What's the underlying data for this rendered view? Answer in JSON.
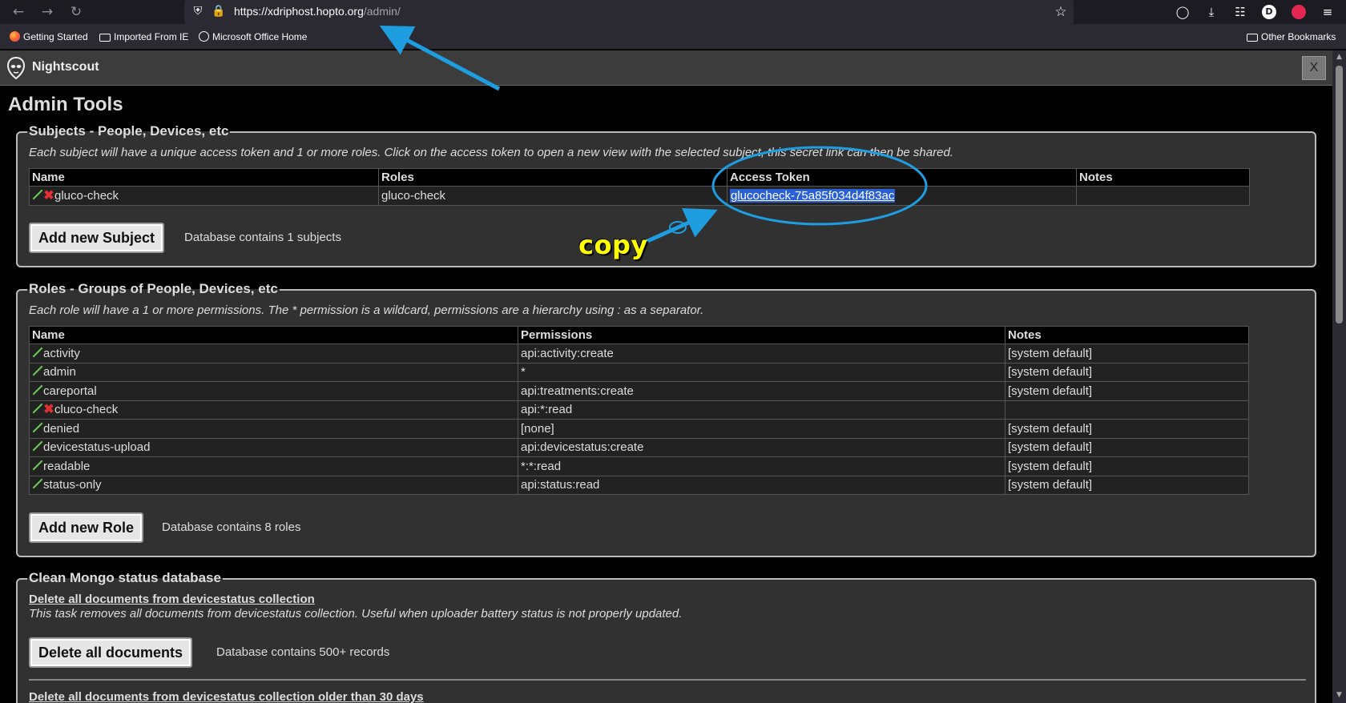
{
  "browser": {
    "url_host": "https://xdriphost.hopto.org",
    "url_path": "/admin/",
    "profile_initial": "D",
    "bookmarks": [
      "Getting Started",
      "Imported From IE",
      "Microsoft Office Home"
    ],
    "other_bookmarks": "Other Bookmarks"
  },
  "app": {
    "name": "Nightscout",
    "close_label": "X"
  },
  "page": {
    "title": "Admin Tools"
  },
  "subjects": {
    "legend": "Subjects - People, Devices, etc",
    "description": "Each subject will have a unique access token and 1 or more roles. Click on the access token to open a new view with the selected subject, this secret link can then be shared.",
    "columns": [
      "Name",
      "Roles",
      "Access Token",
      "Notes"
    ],
    "rows": [
      {
        "name": "gluco-check",
        "roles": "gluco-check",
        "token": "glucocheck-75a85f034d4f83ac",
        "notes": ""
      }
    ],
    "add_button": "Add new Subject",
    "count_text": "Database contains 1 subjects"
  },
  "roles": {
    "legend": "Roles - Groups of People, Devices, etc",
    "description": "Each role will have a 1 or more permissions. The * permission is a wildcard, permissions are a hierarchy using : as a separator.",
    "columns": [
      "Name",
      "Permissions",
      "Notes"
    ],
    "rows": [
      {
        "name": "activity",
        "permissions": "api:activity:create",
        "notes": "[system default]"
      },
      {
        "name": "admin",
        "permissions": "*",
        "notes": "[system default]"
      },
      {
        "name": "careportal",
        "permissions": "api:treatments:create",
        "notes": "[system default]"
      },
      {
        "name": "cluco-check",
        "permissions": "api:*:read",
        "notes": ""
      },
      {
        "name": "denied",
        "permissions": "[none]",
        "notes": "[system default]"
      },
      {
        "name": "devicestatus-upload",
        "permissions": "api:devicestatus:create",
        "notes": "[system default]"
      },
      {
        "name": "readable",
        "permissions": "*:*:read",
        "notes": "[system default]"
      },
      {
        "name": "status-only",
        "permissions": "api:status:read",
        "notes": "[system default]"
      }
    ],
    "add_button": "Add new Role",
    "count_text": "Database contains 8 roles"
  },
  "mongo": {
    "legend": "Clean Mongo status database",
    "task1_title": "Delete all documents from devicestatus collection",
    "task1_desc": "This task removes all documents from devicestatus collection. Useful when uploader battery status is not properly updated.",
    "task1_button": "Delete all documents",
    "task1_count": "Database contains 500+ records",
    "task2_title": "Delete all documents from devicestatus collection older than 30 days"
  },
  "annotation": {
    "copy_label": "copy",
    "accent_color": "#1e9ee0",
    "label_color": "#ffff00"
  }
}
